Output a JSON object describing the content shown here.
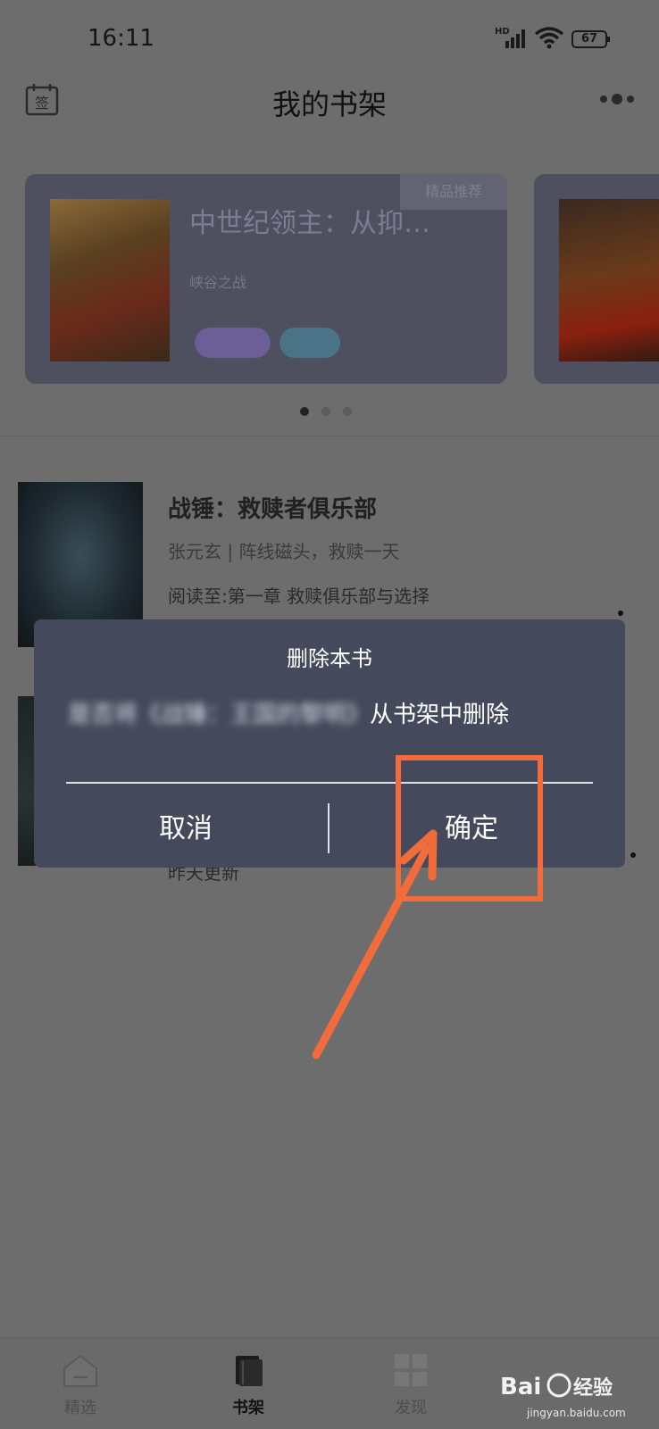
{
  "status_bar": {
    "time": "16:11",
    "network_label": "HD",
    "battery": "67"
  },
  "header": {
    "title": "我的书架"
  },
  "banner": {
    "book_title": "中世纪领主：从抑…",
    "author": "峡谷之战",
    "corner_label": "精品推荐"
  },
  "book_list": [
    {
      "title": "战锤：救赎者俱乐部",
      "meta": "张元玄 | 阵线磁头，救赎一天",
      "progress": "阅读至:第一章 救赎俱乐部与选择"
    },
    {
      "update": "昨天更新"
    }
  ],
  "dialog": {
    "title": "删除本书",
    "message_blurred": "是否将《战锤：王国的黎明》",
    "message_clear": "从书架中删除",
    "cancel_label": "取消",
    "confirm_label": "确定"
  },
  "tabs": [
    {
      "label": "精选",
      "icon": "home-icon"
    },
    {
      "label": "书架",
      "icon": "bookshelf-icon"
    },
    {
      "label": "发现",
      "icon": "grid-icon"
    }
  ],
  "watermark": {
    "text": "Baidu经验",
    "sub": "jingyan.baidu.com"
  },
  "colors": {
    "annotation": "#f26c3b",
    "dialog_bg": "#444a5c",
    "overlay": "#6d6d6d"
  }
}
